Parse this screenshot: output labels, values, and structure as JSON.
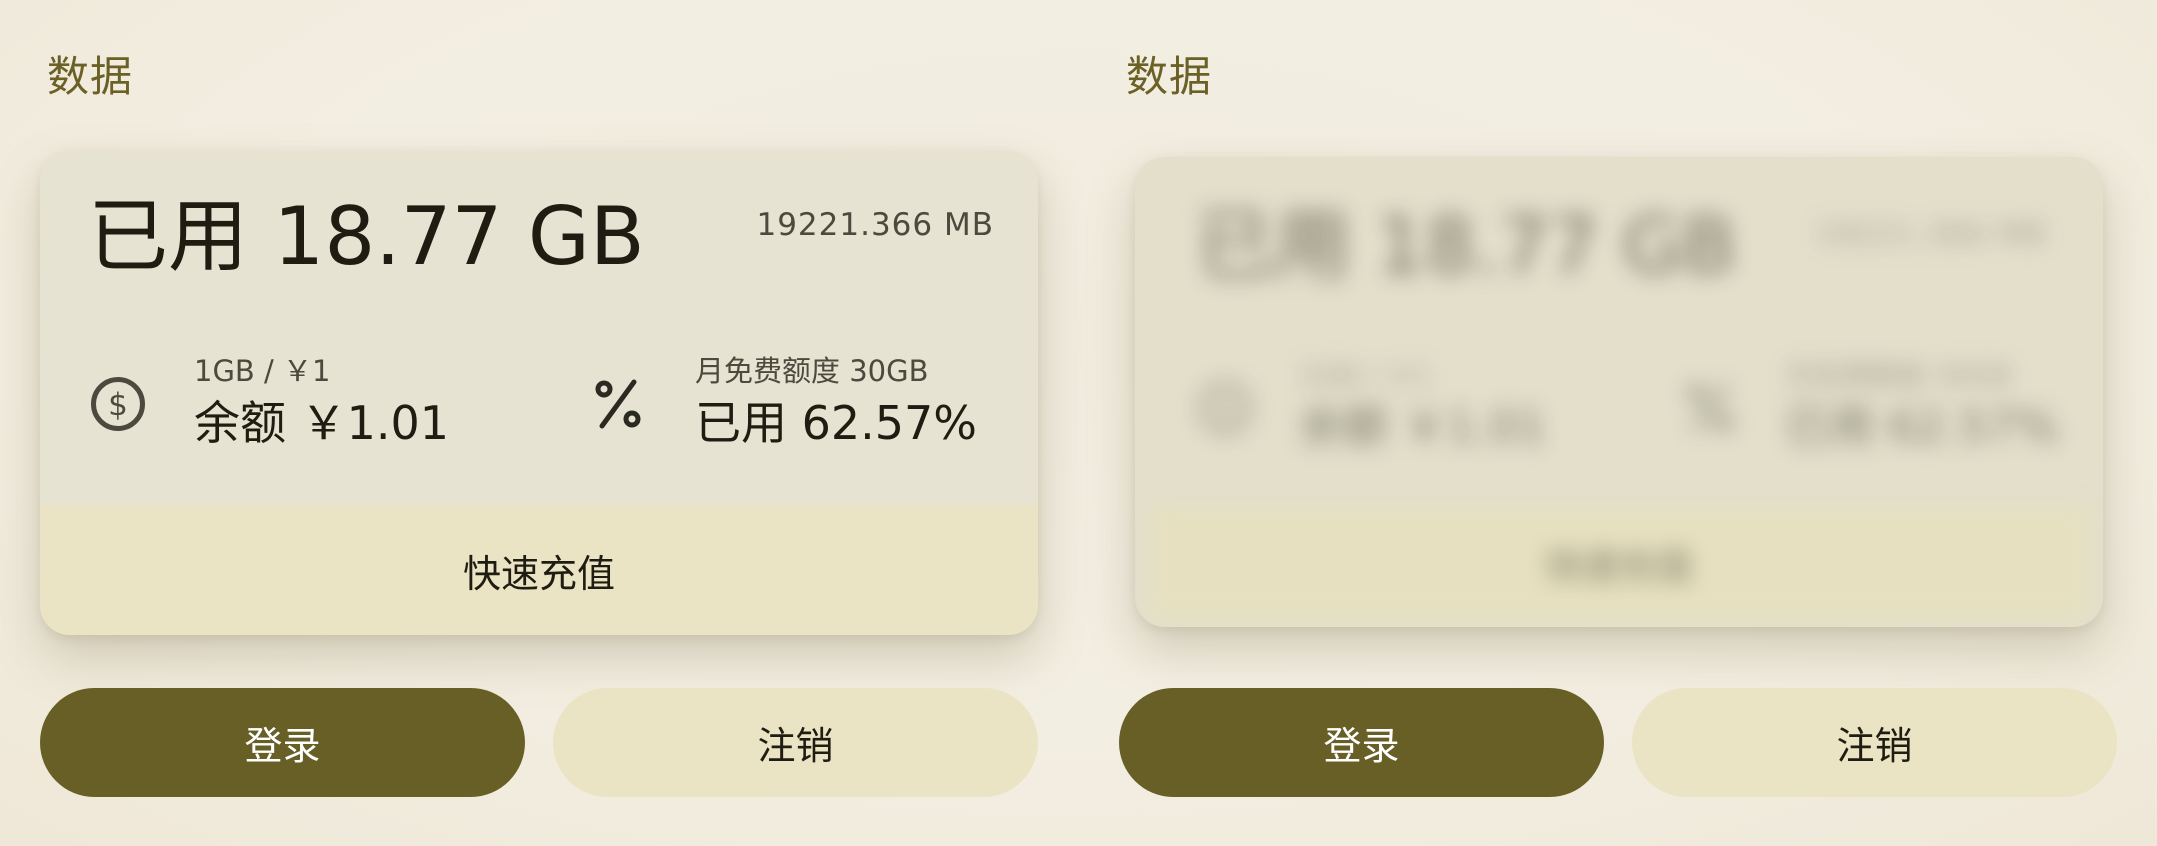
{
  "colors": {
    "primary": "#675f26",
    "title": "#6b6127",
    "card": "#e7e3d2",
    "secondary_container": "#eae4c4",
    "text_dark": "#1f1c12",
    "text_muted": "#4c4a3e",
    "background": "#f1ecdf"
  },
  "panels": [
    {
      "title": "数据",
      "blurred": false,
      "card": {
        "used_label": "已用 18.77 GB",
        "total_mb": "19221.366 MB",
        "balance_rate": "1GB / ￥1",
        "balance_label": "余额 ￥1.01",
        "balance_icon": "dollar-circle-icon",
        "quota_label": "月免费额度 30GB",
        "quota_used": "已用 62.57%",
        "quota_icon": "percent-icon",
        "recharge_button": "快速充值"
      },
      "login_button": "登录",
      "logout_button": "注销"
    },
    {
      "title": "数据",
      "blurred": true,
      "card": {
        "used_label": "已用 18.77 GB",
        "total_mb": "19221.366 MB",
        "balance_rate": "1GB / ￥1",
        "balance_label": "余额 ￥1.01",
        "balance_icon": "dollar-circle-icon",
        "quota_label": "月免费额度 30GB",
        "quota_used": "已用 62.57%",
        "quota_icon": "percent-icon",
        "recharge_button": "快速充值"
      },
      "login_button": "登录",
      "logout_button": "注销"
    }
  ]
}
